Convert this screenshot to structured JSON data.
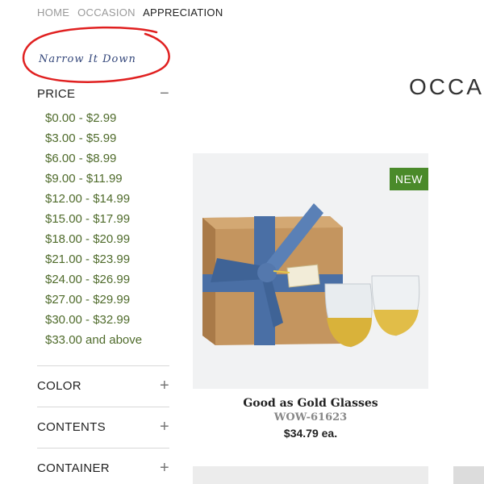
{
  "breadcrumb": {
    "items": [
      "HOME",
      "OCCASION"
    ],
    "current": "APPRECIATION"
  },
  "sidebar": {
    "title": "Narrow It Down",
    "price": {
      "label": "PRICE",
      "toggle": "−",
      "ranges": [
        "$0.00 - $2.99",
        "$3.00 - $5.99",
        "$6.00 - $8.99",
        "$9.00 - $11.99",
        "$12.00 - $14.99",
        "$15.00 - $17.99",
        "$18.00 - $20.99",
        "$21.00 - $23.99",
        "$24.00 - $26.99",
        "$27.00 - $29.99",
        "$30.00 - $32.99",
        "$33.00 and above"
      ]
    },
    "filters": [
      {
        "label": "COLOR",
        "toggle": "+"
      },
      {
        "label": "CONTENTS",
        "toggle": "+"
      },
      {
        "label": "CONTAINER",
        "toggle": "+"
      }
    ]
  },
  "main": {
    "heading": "OCCA"
  },
  "product": {
    "badge": "NEW",
    "name": "Good as Gold Glasses",
    "sku": "WOW-61623",
    "price": "$34.79 ea."
  },
  "colors": {
    "accent_green": "#4a8a2a",
    "price_link": "#4f6b2b",
    "annotation_red": "#e02020",
    "ribbon_blue": "#4a6fa5",
    "kraft_box": "#b98a58",
    "gold": "#d9b23a"
  }
}
